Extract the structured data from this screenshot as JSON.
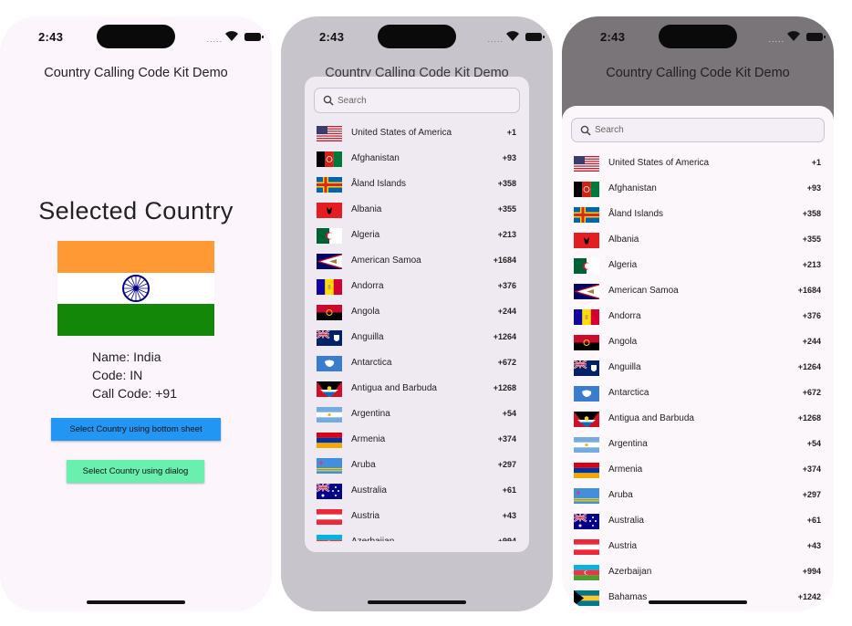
{
  "status": {
    "time": "2:43",
    "signal": "....."
  },
  "app_title": "Country Calling Code Kit Demo",
  "main": {
    "selected_title": "Selected Country",
    "name_line": "Name: India",
    "code_line": "Code: IN",
    "call_code_line": "Call Code: +91",
    "bottom_sheet_button": "Select Country using bottom sheet",
    "dialog_button": "Select Country using dialog"
  },
  "picker": {
    "search_placeholder": "Search",
    "countries": [
      {
        "name": "United States of America",
        "code": "+1",
        "flag": "us-flag-icon"
      },
      {
        "name": "Afghanistan",
        "code": "+93",
        "flag": "af-flag-icon"
      },
      {
        "name": "Åland Islands",
        "code": "+358",
        "flag": "ax-flag-icon"
      },
      {
        "name": "Albania",
        "code": "+355",
        "flag": "al-flag-icon"
      },
      {
        "name": "Algeria",
        "code": "+213",
        "flag": "dz-flag-icon"
      },
      {
        "name": "American Samoa",
        "code": "+1684",
        "flag": "as-flag-icon"
      },
      {
        "name": "Andorra",
        "code": "+376",
        "flag": "ad-flag-icon"
      },
      {
        "name": "Angola",
        "code": "+244",
        "flag": "ao-flag-icon"
      },
      {
        "name": "Anguilla",
        "code": "+1264",
        "flag": "ai-flag-icon"
      },
      {
        "name": "Antarctica",
        "code": "+672",
        "flag": "aq-flag-icon"
      },
      {
        "name": "Antigua and Barbuda",
        "code": "+1268",
        "flag": "ag-flag-icon"
      },
      {
        "name": "Argentina",
        "code": "+54",
        "flag": "ar-flag-icon"
      },
      {
        "name": "Armenia",
        "code": "+374",
        "flag": "am-flag-icon"
      },
      {
        "name": "Aruba",
        "code": "+297",
        "flag": "aw-flag-icon"
      },
      {
        "name": "Australia",
        "code": "+61",
        "flag": "au-flag-icon"
      },
      {
        "name": "Austria",
        "code": "+43",
        "flag": "at-flag-icon"
      },
      {
        "name": "Azerbaijan",
        "code": "+994",
        "flag": "az-flag-icon"
      },
      {
        "name": "Bahamas",
        "code": "+1242",
        "flag": "bs-flag-icon"
      }
    ]
  },
  "colors": {
    "india_saffron": "#ff9933",
    "india_white": "#ffffff",
    "india_green": "#138808",
    "india_chakra": "#000080",
    "bottom_sheet_button": "#2196f3",
    "dialog_button": "#69f0ae"
  }
}
